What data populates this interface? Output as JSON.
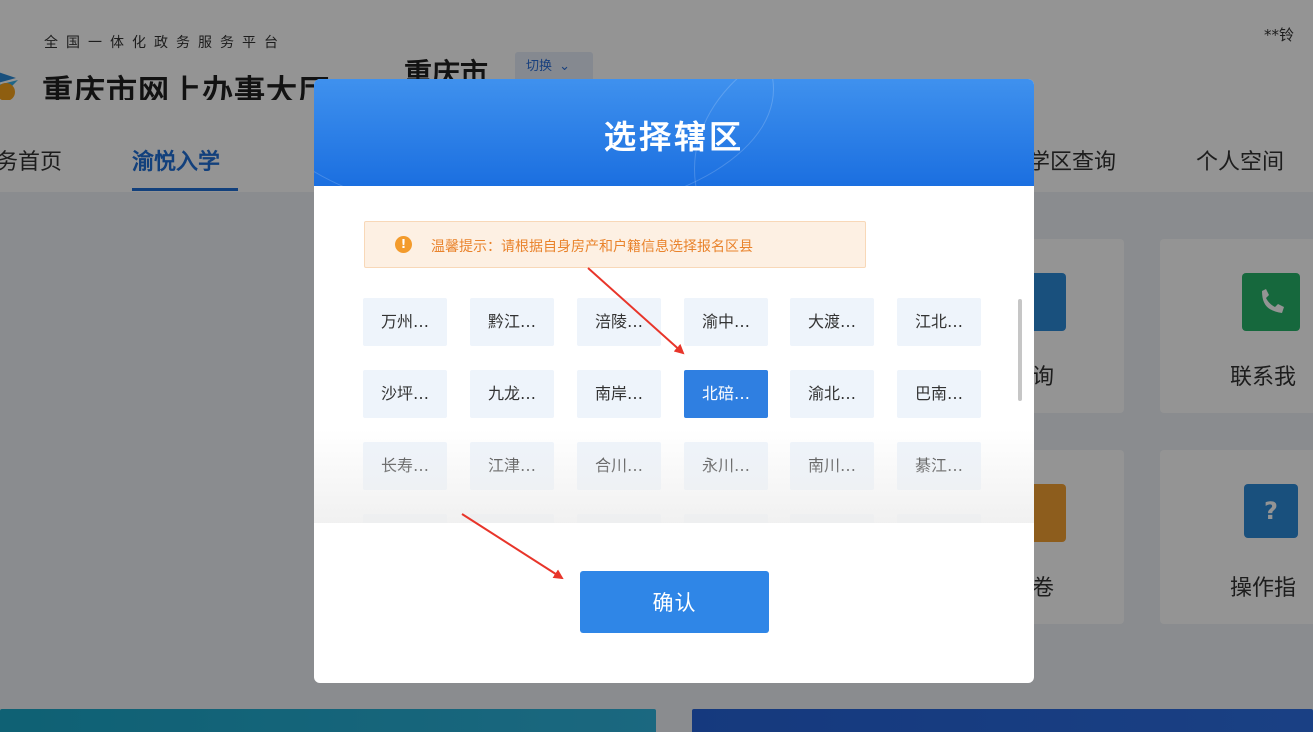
{
  "header": {
    "slogan": "全国一体化政务服务平台",
    "site_title": "重庆市网上办事大厅",
    "city": "重庆市",
    "switch_label": "切换",
    "user": "**铃"
  },
  "nav": {
    "items": [
      "务首页",
      "渝悦入学",
      "学区查询",
      "个人空间"
    ]
  },
  "cards": {
    "labels": [
      "询",
      "联系我",
      "卷",
      "操作指"
    ]
  },
  "modal": {
    "title": "选择辖区",
    "tip": "温馨提示：请根据自身房产和户籍信息选择报名区县",
    "districts": [
      "万州…",
      "黔江…",
      "涪陵…",
      "渝中…",
      "大渡…",
      "江北…",
      "沙坪…",
      "九龙…",
      "南岸…",
      "北碚…",
      "渝北…",
      "巴南…",
      "长寿…",
      "江津…",
      "合川…",
      "永川…",
      "南川…",
      "綦江…"
    ],
    "selected_district": "北碚…",
    "confirm_label": "确认"
  },
  "colors": {
    "primary": "#2f7fe1",
    "header_gradient_top": "#3f91ee",
    "header_gradient_bottom": "#1b6fe0",
    "tip_text": "#e9832c",
    "arrow": "#e8352a"
  }
}
